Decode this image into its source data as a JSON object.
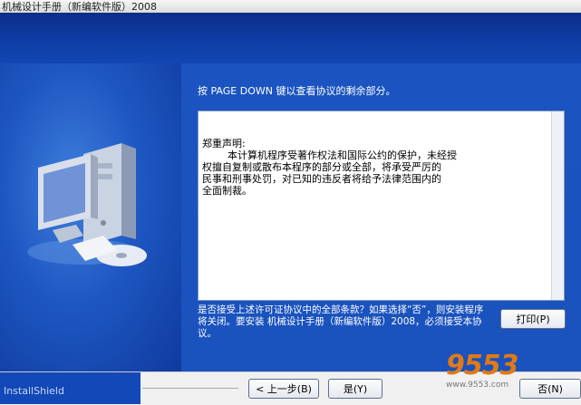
{
  "window": {
    "title": "机械设计手册（新编软件版）2008"
  },
  "instruction": "按 PAGE DOWN 键以查看协议的剩余部分。",
  "license": {
    "text": "郑重声明:\n        本计算机程序受著作权法和国际公约的保护，未经授\n权擅自复制或散布本程序的部分或全部，将承受严厉的\n民事和刑事处罚，对已知的违反者将给予法律范围内的\n全面制裁。"
  },
  "question": "是否接受上述许可证协议中的全部条款？如果选择“否”，则安装程序将关闭。要安装 机械设计手册（新编软件版）2008，必须接受本协议。",
  "buttons": {
    "print": "打印(P)",
    "back": "< 上一步(B)",
    "yes": "是(Y)",
    "no": "否(N)"
  },
  "footer": {
    "brand": "InstallShield"
  },
  "watermark": {
    "text": "9553",
    "sub": "www.9553.com"
  }
}
